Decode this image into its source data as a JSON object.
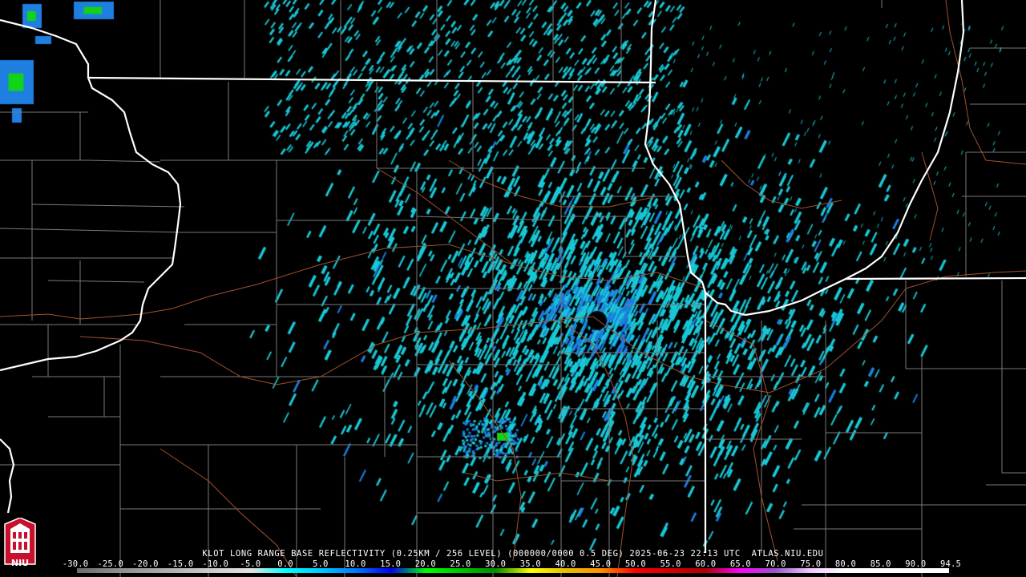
{
  "product": {
    "caption": "KLOT LONG RANGE BASE REFLECTIVITY (0.25KM / 256 LEVEL) (000000/0000 0.5 DEG) 2025-06-23 22:13 UTC  ATLAS.NIU.EDU"
  },
  "legend": {
    "ticks": [
      "-30.0",
      "-25.0",
      "-20.0",
      "-15.0",
      "-10.0",
      "-5.0",
      "0.0",
      "5.0",
      "10.0",
      "15.0",
      "20.0",
      "25.0",
      "30.0",
      "35.0",
      "40.0",
      "45.0",
      "50.0",
      "55.0",
      "60.0",
      "65.0",
      "70.0",
      "75.0",
      "80.0",
      "85.0",
      "90.0",
      "94.5"
    ],
    "colors": [
      "#6b6b6b",
      "#8a8a8a",
      "#a0a0a0",
      "#b8b8b8",
      "#cfcfcf",
      "#e2e2e2",
      "#00ffff",
      "#00c8ff",
      "#0078ff",
      "#0000f5",
      "#00ff00",
      "#00c400",
      "#008c00",
      "#ffff00",
      "#e6be00",
      "#ff9000",
      "#ff0000",
      "#d60000",
      "#b00000",
      "#ff00ff",
      "#9955c9",
      "#f0c8ff",
      "#ffffff",
      "#ffffff",
      "#ffffff",
      "#ffffff"
    ]
  },
  "logo": {
    "text": "NIU"
  },
  "colors": {
    "background": "#000000",
    "state_border": "#ffffff",
    "county_border": "#7a7a7a",
    "highway": "#a0522d",
    "echo_light": "#19c8d6",
    "echo_medium": "#1e7fe0",
    "echo_strong": "#12d21a"
  }
}
